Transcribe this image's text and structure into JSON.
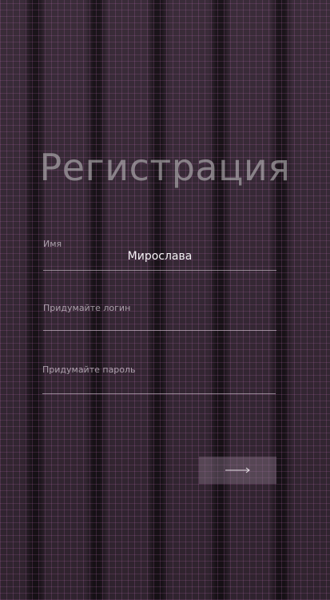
{
  "page": {
    "title": "Регистрация"
  },
  "form": {
    "name": {
      "label": "Имя",
      "value": "Мирослава"
    },
    "login": {
      "label": "Придумайте логин",
      "value": ""
    },
    "password": {
      "label": "Придумайте пароль",
      "value": ""
    },
    "submit": {
      "icon": "arrow-right-icon"
    }
  },
  "colors": {
    "background": "#2a1f29",
    "grid": "#d278c8",
    "text": "#f4f0f4"
  }
}
